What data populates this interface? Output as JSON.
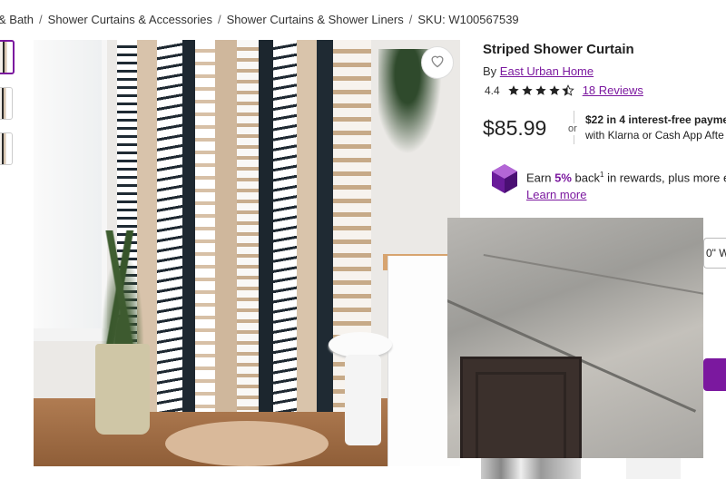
{
  "breadcrumb": {
    "items": [
      "& Bath",
      "Shower Curtains & Accessories",
      "Shower Curtains & Shower Liners",
      "SKU: W100567539"
    ],
    "separator": "/"
  },
  "product": {
    "title": "Striped Shower Curtain",
    "by_prefix": "By",
    "brand": "East Urban Home",
    "rating_value": "4.4",
    "stars_full": 4,
    "stars_fraction": 0.4,
    "reviews_label": "18 Reviews",
    "price": "$85.99",
    "or_label": "or",
    "klarna_line1": "$22 in 4 interest-free payme",
    "klarna_line2": "with Klarna or Cash App Afte",
    "rewards_prefix": "Earn",
    "rewards_pct": "5%",
    "rewards_mid": "back",
    "rewards_sup": "1",
    "rewards_suffix": "in rewards, plus more excl",
    "rewards_link": "Learn more",
    "side_box_text": "0\" W"
  },
  "icons": {
    "heart": "heart-outline-icon",
    "rewards": "purple-gem-icon",
    "star": "star-icon"
  },
  "colors": {
    "accent": "#7b189f",
    "text": "#222222",
    "star": "#222222"
  }
}
